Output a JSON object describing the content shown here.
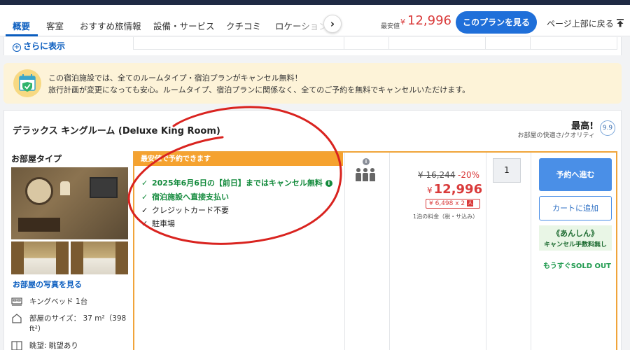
{
  "nav": {
    "tabs": [
      {
        "label": "概要"
      },
      {
        "label": "客室"
      },
      {
        "label": "おすすめ旅情報"
      },
      {
        "label": "設備・サービス"
      },
      {
        "label": "クチコミ"
      },
      {
        "label": "ロケーション"
      }
    ],
    "min_price_label": "最安値",
    "min_price_currency": "¥",
    "min_price_value": "12,996",
    "plan_button": "このプランを見る",
    "page_top_link": "ページ上部に戻る",
    "arrow_glyph": "›"
  },
  "previous_section": {
    "more_link": "さらに表示"
  },
  "notice": {
    "line1": "この宿泊施設では、全てのルームタイプ・宿泊プランがキャンセル無料！",
    "line2": "旅行計画が変更になっても安心。ルームタイプ、宿泊プランに関係なく、全てのご予約を無料でキャンセルいただけます。"
  },
  "room": {
    "title": "デラックス キングルーム (Deluxe King Room)",
    "score_label": "最高!",
    "score_sub": "お部屋の快適さ/クオリティ",
    "score_value": "9.9",
    "type_label": "お部屋タイプ",
    "photos_link": "お部屋の写真を見る",
    "amenities": [
      {
        "icon": "bed-icon",
        "text": "キングベッド 1台"
      },
      {
        "icon": "room-size-icon",
        "text_line1": "部屋のサイズ： 37 m²（398",
        "text_line2": "ft²）"
      },
      {
        "icon": "view-icon",
        "text": "眺望: 眺望あり"
      }
    ]
  },
  "plan": {
    "banner": "最安値で予約できます",
    "features": [
      {
        "text": "2025年6月6日の【前日】まではキャンセル無料",
        "green": true,
        "info": true
      },
      {
        "text": "宿泊施設へ直接支払い",
        "green": true
      },
      {
        "text": "クレジットカード不要",
        "green": false
      },
      {
        "text": "駐車場",
        "green": false
      }
    ],
    "check_glyph": "✓",
    "info_glyph": "i",
    "occupancy": 3,
    "old_price": "¥ 16,244",
    "discount": "-20%",
    "new_price_currency": "¥",
    "new_price": "12,996",
    "per_person": "¥ 6,498 x 2",
    "per_person_icon_glyph": "人",
    "tax_note": "1泊の料金（税・サ込み）",
    "quantity": "1",
    "reserve_button": "予約へ進む",
    "cart_button": "カートに追加",
    "anshin_title": "《あんしん》",
    "anshin_sub": "キャンセル手数料無し",
    "soldout": "もうすぐSOLD OUT"
  },
  "colors": {
    "accent_blue": "#1f6fd9",
    "price_red": "#d93a3a",
    "banner_orange": "#f5a22f",
    "success_green": "#138a3c",
    "annotation_red": "#d9231f"
  }
}
